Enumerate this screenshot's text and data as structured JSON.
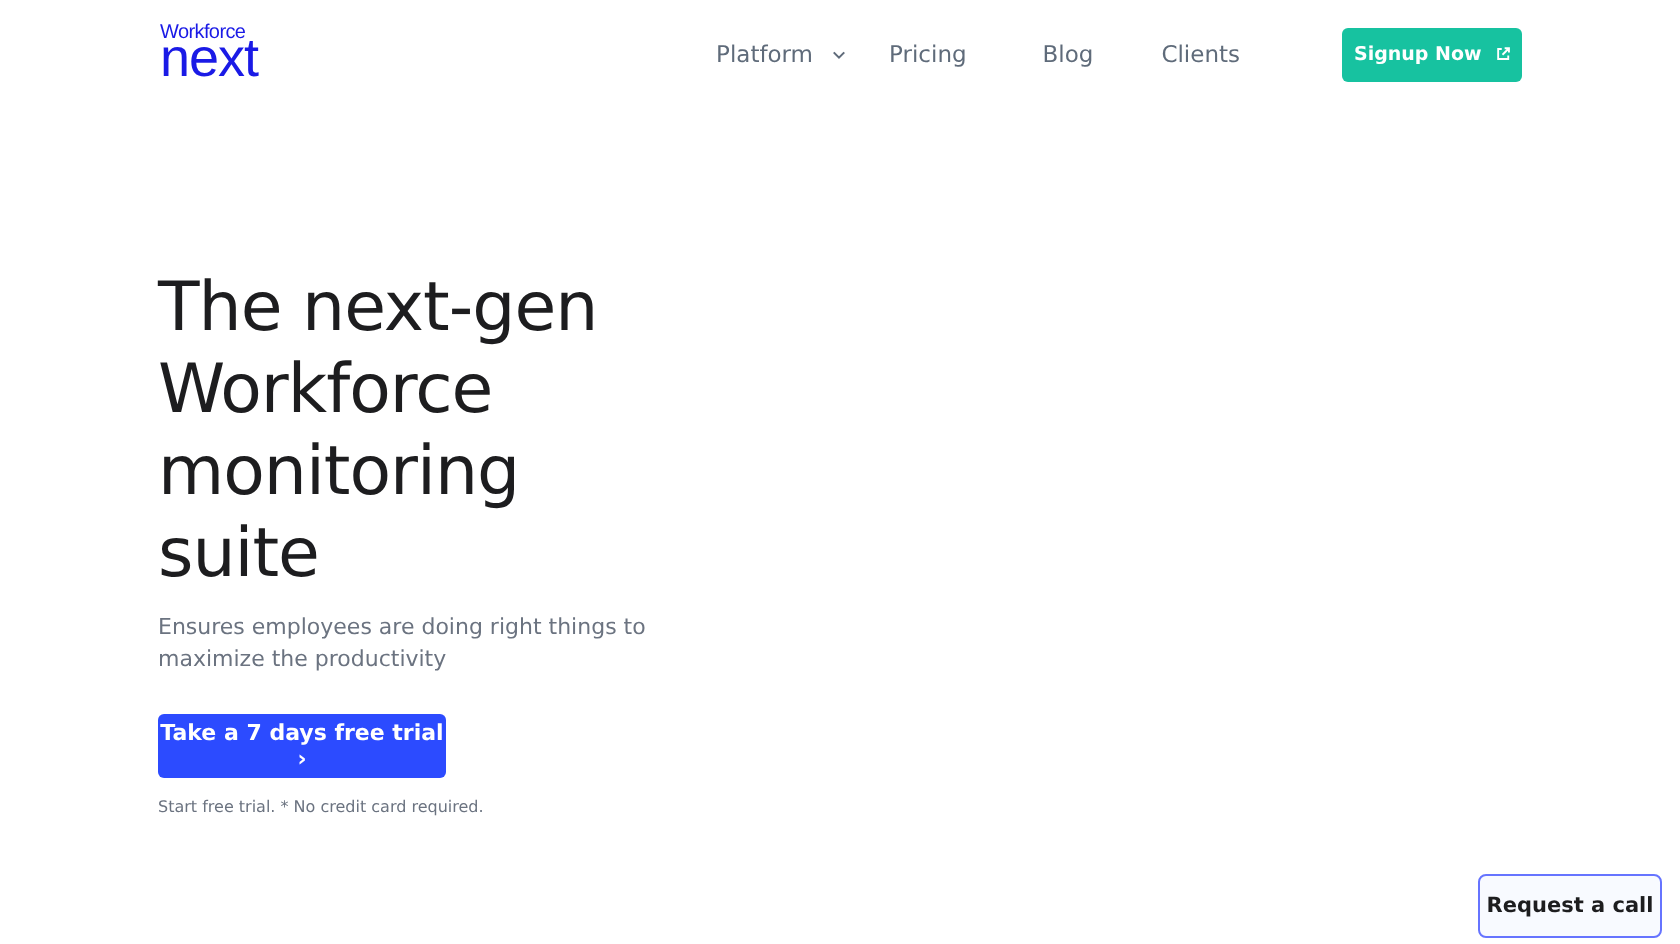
{
  "logo": {
    "top": "Workforce",
    "bottom": "next"
  },
  "nav": [
    {
      "label": "Platform",
      "kind": "dropdown"
    },
    {
      "label": "Pricing",
      "kind": "link"
    },
    {
      "label": "Blog",
      "kind": "link"
    },
    {
      "label": "Clients",
      "kind": "link"
    }
  ],
  "signup_button": "Signup Now",
  "hero": {
    "title_lines": [
      "The next-gen",
      "Workforce",
      "monitoring",
      "suite"
    ],
    "subtitle": "Ensures employees are doing right things to maximize the productivity",
    "cta": "Take a 7 days free trial ›",
    "note": "Start free trial. * No credit card required."
  },
  "request_call_button": "Request a call"
}
